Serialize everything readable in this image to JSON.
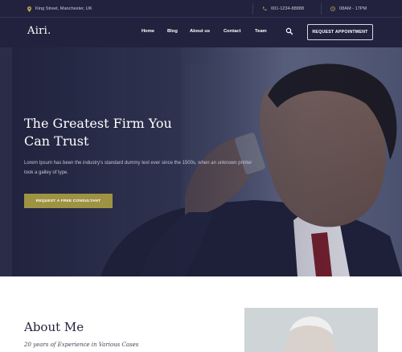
{
  "topbar": {
    "address": "King Street, Manchester, UK",
    "phone": "001-1234-88888",
    "hours": "08AM - 17PM",
    "address_icon": "location-pin-icon",
    "phone_icon": "phone-icon",
    "hours_icon": "clock-icon"
  },
  "header": {
    "logo": "Airi.",
    "nav": [
      "Home",
      "Blog",
      "About us",
      "Contact",
      "Team"
    ],
    "search_icon": "search-icon",
    "cta_label": "REQUEST APPOINTMENT"
  },
  "hero": {
    "title": "The Greatest Firm You Can Trust",
    "text": "Lorem Ipsum has been the industry's standard dummy text ever since the 1500s, when an unknown printer took a galley of type.",
    "button_label": "REQUEST A FREE CONSULTANT",
    "accent_color": "#9e9343"
  },
  "about": {
    "title": "About Me",
    "subtitle": "20 years of Experience in Various Cases"
  },
  "colors": {
    "header_bg": "#22223e",
    "accent": "#9e9343"
  }
}
